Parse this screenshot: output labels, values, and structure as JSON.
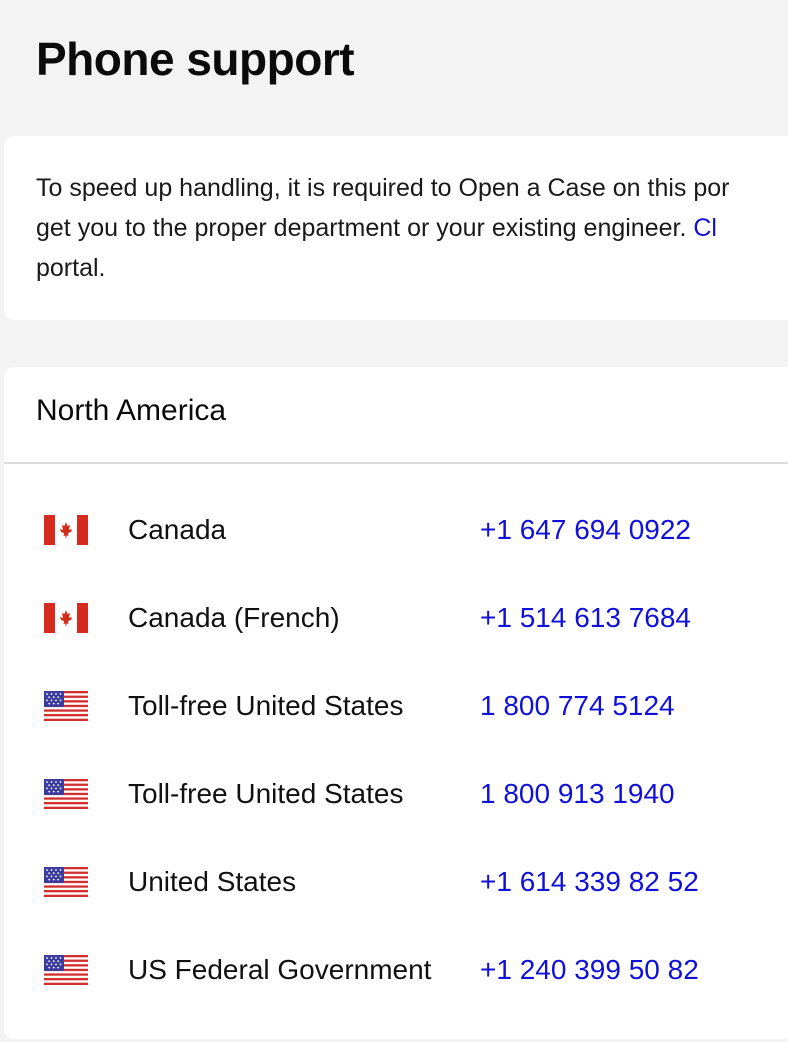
{
  "page": {
    "title": "Phone support"
  },
  "info": {
    "line1": "To speed up handling, it is required to Open a Case on this por",
    "line2_prefix": "get you to the proper department or your existing engineer. ",
    "line2_link": "Cl",
    "line3": "portal."
  },
  "region": {
    "title": "North America",
    "entries": [
      {
        "country": "Canada",
        "phone": "+1 647 694 0922",
        "flag": "canada-flag"
      },
      {
        "country": "Canada (French)",
        "phone": "+1 514 613 7684",
        "flag": "canada-flag"
      },
      {
        "country": "Toll-free United States",
        "phone": "1 800 774 5124",
        "flag": "us-flag"
      },
      {
        "country": "Toll-free United States",
        "phone": "1 800 913 1940",
        "flag": "us-flag"
      },
      {
        "country": "United States",
        "phone": "+1 614 339 82 52",
        "flag": "us-flag"
      },
      {
        "country": "US Federal Government",
        "phone": "+1 240 399 50 82",
        "flag": "us-flag"
      }
    ]
  },
  "colors": {
    "background": "#f3f3f3",
    "card": "#ffffff",
    "link": "#1010d8",
    "text": "#111111",
    "divider": "#dcdcdc"
  }
}
